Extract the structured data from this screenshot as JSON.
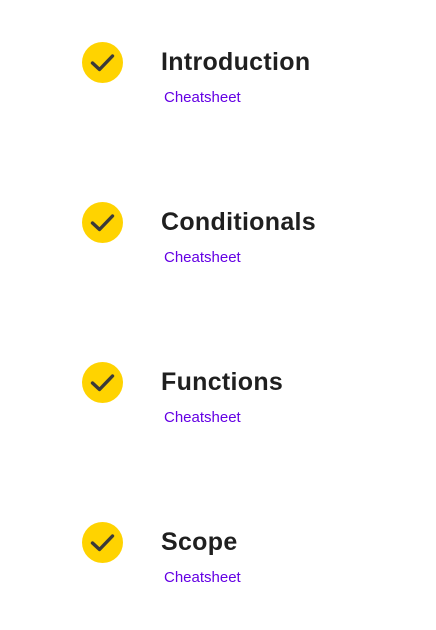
{
  "accent_color": "#FFD300",
  "link_color": "#6400E4",
  "modules": [
    {
      "title": "Introduction",
      "link": "Cheatsheet",
      "status_icon": "checkmark-icon",
      "completed": true
    },
    {
      "title": "Conditionals",
      "link": "Cheatsheet",
      "status_icon": "checkmark-icon",
      "completed": true
    },
    {
      "title": "Functions",
      "link": "Cheatsheet",
      "status_icon": "checkmark-icon",
      "completed": true
    },
    {
      "title": "Scope",
      "link": "Cheatsheet",
      "status_icon": "checkmark-icon",
      "completed": true
    }
  ]
}
